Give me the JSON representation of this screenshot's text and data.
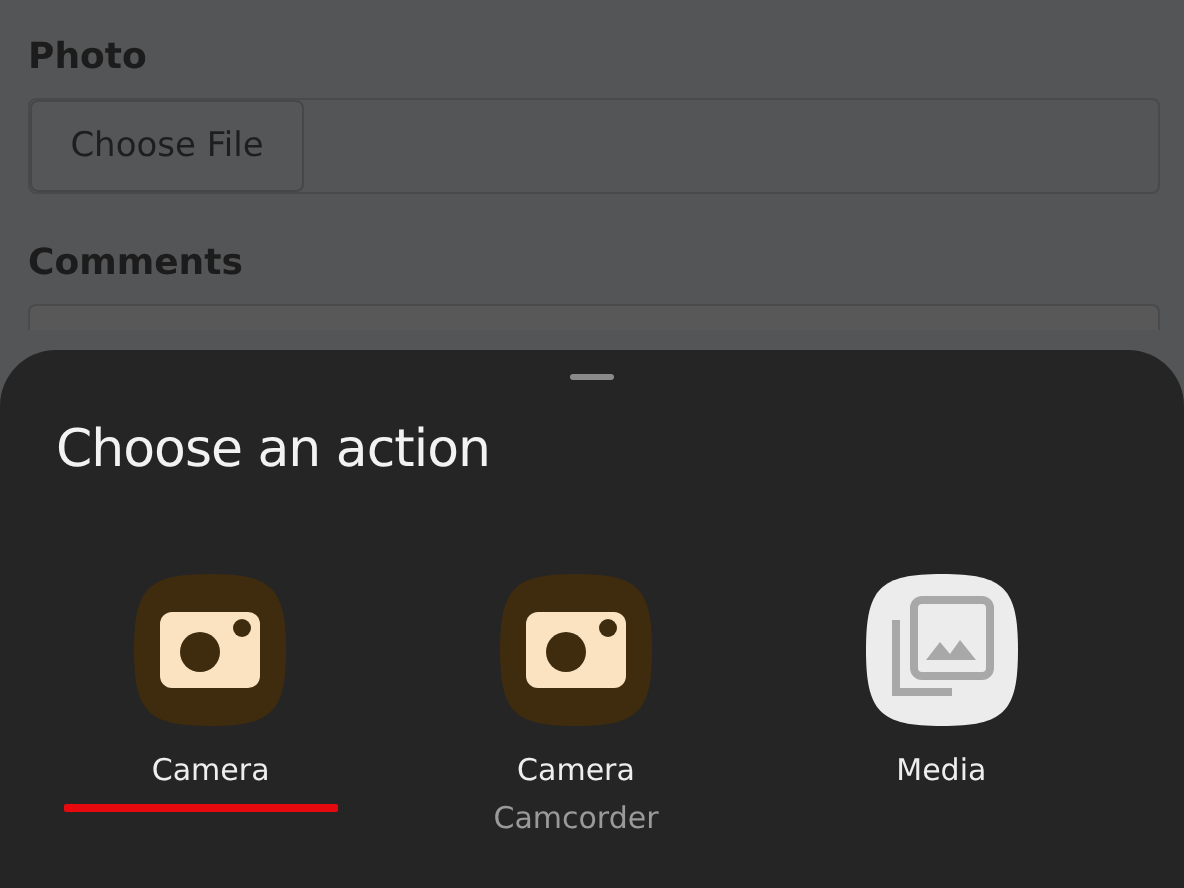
{
  "form": {
    "fields": [
      {
        "kind": "file",
        "label": "Photo",
        "button": "Choose File"
      },
      {
        "kind": "textarea",
        "label": "Comments"
      }
    ]
  },
  "sheet": {
    "title": "Choose an action",
    "apps": [
      {
        "kind": "camera",
        "name": "Camera",
        "underlined": true
      },
      {
        "kind": "camera",
        "name": "Camera",
        "sublabel": "Camcorder",
        "underlined": false
      },
      {
        "kind": "gallery",
        "name": "Media",
        "underlined": false
      }
    ]
  }
}
